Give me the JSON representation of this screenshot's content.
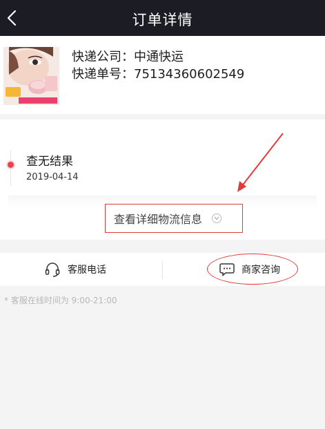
{
  "header": {
    "title": "订单详情",
    "back_icon": "chevron-left-icon"
  },
  "shipment": {
    "product_image": "product-thumbnail",
    "company_label": "快递公司：",
    "company_value": "中通快运",
    "tracking_label": "快递单号：",
    "tracking_value": "75134360602549"
  },
  "tracking": {
    "status": "查无结果",
    "date": "2019-04-14",
    "detail_link": "查看详细物流信息",
    "accent_color": "#e6434d"
  },
  "actions": {
    "phone_label": "客服电话",
    "phone_icon": "headset-icon",
    "consult_label": "商家咨询",
    "consult_icon": "chat-bubble-icon"
  },
  "note": "* 客服在线时间为 9:00-21:00",
  "colors": {
    "nav_bg": "#1c1c24",
    "annotation": "#e23a3a"
  }
}
